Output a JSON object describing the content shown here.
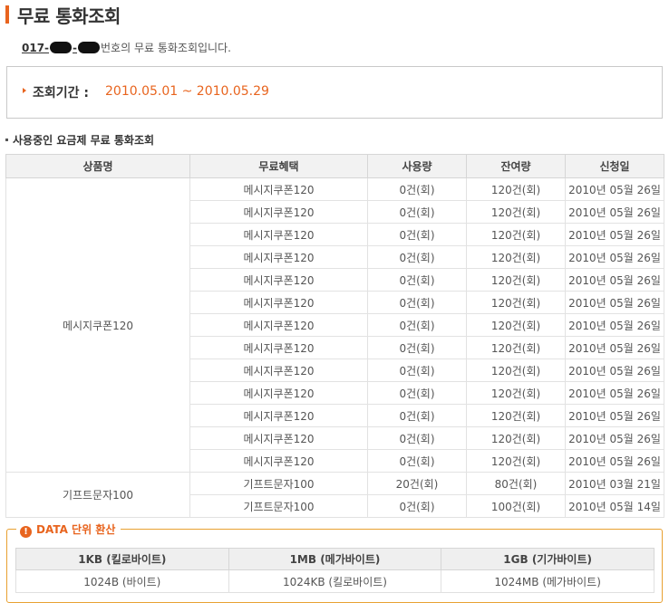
{
  "page": {
    "title": "무료 통화조회",
    "intro_number_prefix": "017-",
    "intro_suffix": "번호의 무료 통화조회입니다."
  },
  "period": {
    "label": "조회기간 :",
    "value": "2010.05.01 ~ 2010.05.29"
  },
  "usage": {
    "section_title": "사용중인 요금제 무료 통화조회",
    "headers": [
      "상품명",
      "무료혜택",
      "사용량",
      "잔여량",
      "신청일"
    ],
    "groups": [
      {
        "product": "메시지쿠폰120",
        "rows": [
          {
            "benefit": "메시지쿠폰120",
            "used": "0건(회)",
            "remaining": "120건(회)",
            "date": "2010년 05월 26일"
          },
          {
            "benefit": "메시지쿠폰120",
            "used": "0건(회)",
            "remaining": "120건(회)",
            "date": "2010년 05월 26일"
          },
          {
            "benefit": "메시지쿠폰120",
            "used": "0건(회)",
            "remaining": "120건(회)",
            "date": "2010년 05월 26일"
          },
          {
            "benefit": "메시지쿠폰120",
            "used": "0건(회)",
            "remaining": "120건(회)",
            "date": "2010년 05월 26일"
          },
          {
            "benefit": "메시지쿠폰120",
            "used": "0건(회)",
            "remaining": "120건(회)",
            "date": "2010년 05월 26일"
          },
          {
            "benefit": "메시지쿠폰120",
            "used": "0건(회)",
            "remaining": "120건(회)",
            "date": "2010년 05월 26일"
          },
          {
            "benefit": "메시지쿠폰120",
            "used": "0건(회)",
            "remaining": "120건(회)",
            "date": "2010년 05월 26일"
          },
          {
            "benefit": "메시지쿠폰120",
            "used": "0건(회)",
            "remaining": "120건(회)",
            "date": "2010년 05월 26일"
          },
          {
            "benefit": "메시지쿠폰120",
            "used": "0건(회)",
            "remaining": "120건(회)",
            "date": "2010년 05월 26일"
          },
          {
            "benefit": "메시지쿠폰120",
            "used": "0건(회)",
            "remaining": "120건(회)",
            "date": "2010년 05월 26일"
          },
          {
            "benefit": "메시지쿠폰120",
            "used": "0건(회)",
            "remaining": "120건(회)",
            "date": "2010년 05월 26일"
          },
          {
            "benefit": "메시지쿠폰120",
            "used": "0건(회)",
            "remaining": "120건(회)",
            "date": "2010년 05월 26일"
          },
          {
            "benefit": "메시지쿠폰120",
            "used": "0건(회)",
            "remaining": "120건(회)",
            "date": "2010년 05월 26일"
          }
        ]
      },
      {
        "product": "기프트문자100",
        "rows": [
          {
            "benefit": "기프트문자100",
            "used": "20건(회)",
            "remaining": "80건(회)",
            "date": "2010년 03월 21일"
          },
          {
            "benefit": "기프트문자100",
            "used": "0건(회)",
            "remaining": "100건(회)",
            "date": "2010년 05월 14일"
          }
        ]
      }
    ]
  },
  "data_units": {
    "legend": "DATA 단위 환산",
    "icon": "exclamation-icon",
    "headers": [
      "1KB (킬로바이트)",
      "1MB (메가바이트)",
      "1GB (기가바이트)"
    ],
    "values": [
      "1024B (바이트)",
      "1024KB (킬로바이트)",
      "1024MB (메가바이트)"
    ]
  },
  "colors": {
    "accent": "#e8641e",
    "box_border": "#e8a030"
  }
}
